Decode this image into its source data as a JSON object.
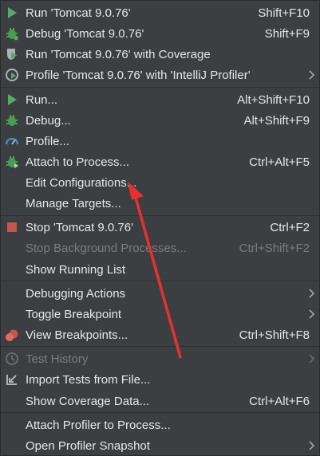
{
  "menu": {
    "run_tomcat": {
      "label": "Run 'Tomcat 9.0.76'",
      "shortcut": "Shift+F10",
      "icon": "run-icon"
    },
    "debug_tomcat": {
      "label": "Debug 'Tomcat 9.0.76'",
      "shortcut": "Shift+F9",
      "icon": "debug-icon"
    },
    "run_coverage": {
      "label": "Run 'Tomcat 9.0.76' with Coverage",
      "shortcut": "",
      "icon": "coverage-icon"
    },
    "profile_tomcat": {
      "label": "Profile 'Tomcat 9.0.76' with 'IntelliJ Profiler'",
      "shortcut": "",
      "icon": "profile-icon"
    },
    "run": {
      "label": "Run...",
      "shortcut": "Alt+Shift+F10",
      "icon": "run-icon"
    },
    "debug": {
      "label": "Debug...",
      "shortcut": "Alt+Shift+F9",
      "icon": "debug-icon"
    },
    "profile": {
      "label": "Profile...",
      "shortcut": "",
      "icon": "profile-gauge-icon"
    },
    "attach": {
      "label": "Attach to Process...",
      "shortcut": "Ctrl+Alt+F5",
      "icon": "attach-debugger-icon"
    },
    "edit_configs": {
      "label": "Edit Configurations...",
      "shortcut": ""
    },
    "manage_targets": {
      "label": "Manage Targets...",
      "shortcut": ""
    },
    "stop_tomcat": {
      "label": "Stop 'Tomcat 9.0.76'",
      "shortcut": "Ctrl+F2",
      "icon": "stop-icon"
    },
    "stop_bg": {
      "label": "Stop Background Processes...",
      "shortcut": "Ctrl+Shift+F2"
    },
    "show_running": {
      "label": "Show Running List",
      "shortcut": ""
    },
    "debugging_actions": {
      "label": "Debugging Actions",
      "shortcut": ""
    },
    "toggle_breakpoint": {
      "label": "Toggle Breakpoint",
      "shortcut": ""
    },
    "view_breakpoints": {
      "label": "View Breakpoints...",
      "shortcut": "Ctrl+Shift+F8",
      "icon": "breakpoints-icon"
    },
    "test_history": {
      "label": "Test History",
      "shortcut": "",
      "icon": "history-icon"
    },
    "import_tests": {
      "label": "Import Tests from File...",
      "shortcut": "",
      "icon": "import-icon"
    },
    "show_coverage": {
      "label": "Show Coverage Data...",
      "shortcut": "Ctrl+Alt+F6"
    },
    "attach_profiler": {
      "label": "Attach Profiler to Process...",
      "shortcut": ""
    },
    "open_snapshot": {
      "label": "Open Profiler Snapshot",
      "shortcut": ""
    }
  },
  "colors": {
    "background": "#3c3f41",
    "text": "#e6e6e6",
    "disabled_text": "#7b7b7b",
    "run_green": "#59a869",
    "debug_green": "#499c54",
    "stop_red": "#c75450",
    "annotation_arrow": "#e8312f"
  }
}
